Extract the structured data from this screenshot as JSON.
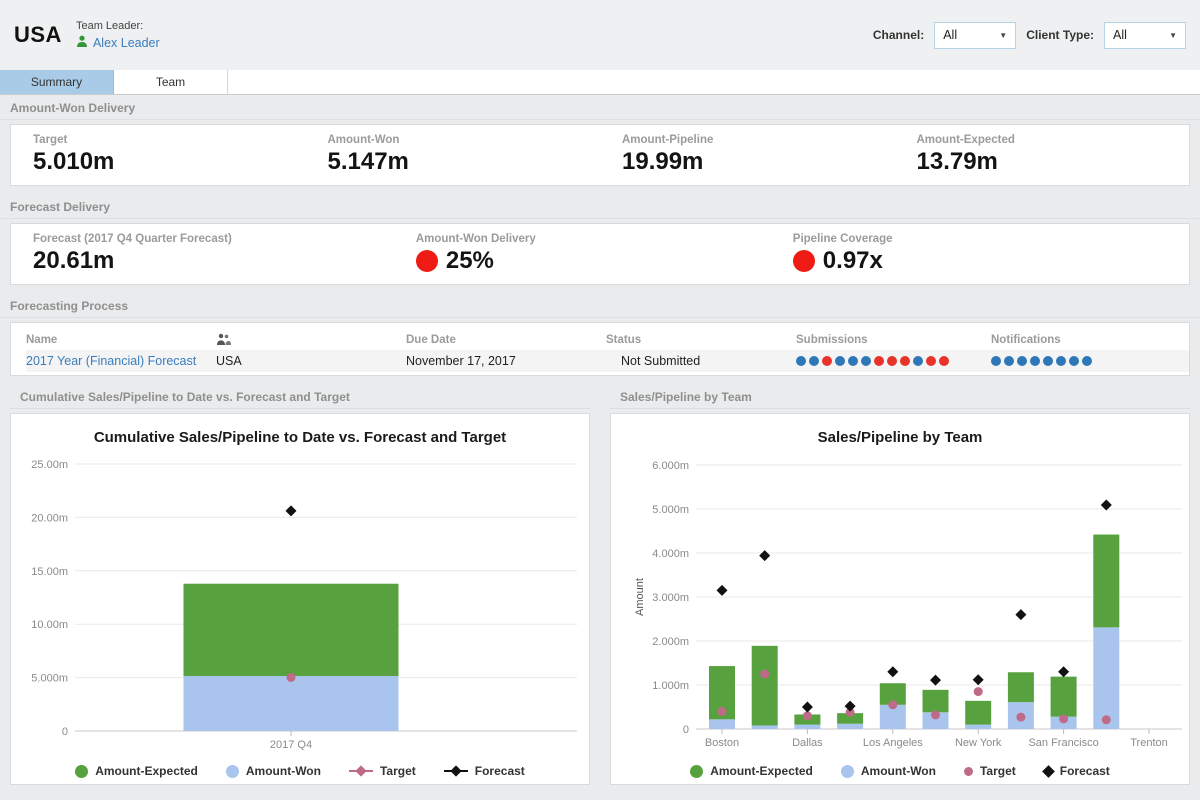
{
  "header": {
    "region": "USA",
    "team_leader_label": "Team Leader:",
    "team_leader_name": "Alex Leader",
    "filters": [
      {
        "label": "Channel:",
        "value": "All"
      },
      {
        "label": "Client Type:",
        "value": "All"
      }
    ]
  },
  "tabs": [
    {
      "label": "Summary"
    },
    {
      "label": "Team"
    }
  ],
  "sections": {
    "amount_won_delivery": {
      "title": "Amount-Won Delivery",
      "kpis": [
        {
          "label": "Target",
          "value": "5.010m"
        },
        {
          "label": "Amount-Won",
          "value": "5.147m"
        },
        {
          "label": "Amount-Pipeline",
          "value": "19.99m"
        },
        {
          "label": "Amount-Expected",
          "value": "13.79m"
        }
      ]
    },
    "forecast_delivery": {
      "title": "Forecast Delivery",
      "kpis": [
        {
          "label": "Forecast (2017 Q4 Quarter Forecast)",
          "value": "20.61m",
          "dot": "none"
        },
        {
          "label": "Amount-Won Delivery",
          "value": "25%",
          "dot": "red"
        },
        {
          "label": "Pipeline Coverage",
          "value": "0.97x",
          "dot": "red"
        }
      ]
    },
    "forecasting_process": {
      "title": "Forecasting Process",
      "col_name": "Name",
      "col_due": "Due Date",
      "col_status": "Status",
      "col_submissions": "Submissions",
      "col_notifications": "Notifications",
      "row": {
        "name": "2017 Year (Financial) Forecast",
        "team": "USA",
        "due_date": "November 17, 2017",
        "status": "Not Submitted",
        "submissions": [
          "blue",
          "blue",
          "red",
          "blue",
          "blue",
          "blue",
          "red",
          "red",
          "red",
          "blue",
          "red",
          "red"
        ],
        "notifications": [
          "blue",
          "blue",
          "blue",
          "blue",
          "blue",
          "blue",
          "blue",
          "blue"
        ]
      }
    }
  },
  "colors": {
    "green": "#57a13e",
    "light_blue": "#a9c5ee",
    "pink": "#c06a8a",
    "black": "#111111",
    "red_indicator": "#ee1c14",
    "blue_dot": "#2e78b8",
    "red_dot": "#e8332a",
    "link": "#3a7dbf",
    "active_tab": "#a9cbe8"
  },
  "chart_data": [
    {
      "type": "bar",
      "title": "Cumulative Sales/Pipeline to Date vs. Forecast and Target",
      "section_title": "Cumulative Sales/Pipeline to Date vs. Forecast and Target",
      "xlabel": "",
      "ylabel": "",
      "ymax": 25,
      "ylim": [
        0,
        25
      ],
      "grid": true,
      "legend_position": "bottom",
      "yticks": [
        {
          "v": 25,
          "label": "25.00m"
        },
        {
          "v": 20,
          "label": "20.00m"
        },
        {
          "v": 15,
          "label": "15.00m"
        },
        {
          "v": 10,
          "label": "10.00m"
        },
        {
          "v": 5,
          "label": "5.000m"
        },
        {
          "v": 0,
          "label": "0"
        }
      ],
      "categories": [
        "2017 Q4"
      ],
      "bars": [
        {
          "category": "2017 Q4",
          "amount_won": 5.147,
          "amount_expected": 8.643,
          "target": 5.01,
          "forecast": 20.61
        }
      ],
      "legend": [
        {
          "label": "Amount-Expected",
          "marker": "circle",
          "color_key": "green"
        },
        {
          "label": "Amount-Won",
          "marker": "circle",
          "color_key": "light_blue"
        },
        {
          "label": "Target",
          "marker": "diamond-line",
          "color_key": "pink"
        },
        {
          "label": "Forecast",
          "marker": "diamond-line",
          "color_key": "black"
        }
      ]
    },
    {
      "type": "bar",
      "title": "Sales/Pipeline by Team",
      "section_title": "Sales/Pipeline by Team",
      "xlabel": "",
      "ylabel": "Amount",
      "ymax": 6,
      "ylim": [
        0,
        6
      ],
      "grid": true,
      "legend_position": "bottom",
      "yticks": [
        {
          "v": 6,
          "label": "6.000m"
        },
        {
          "v": 5,
          "label": "5.000m"
        },
        {
          "v": 4,
          "label": "4.000m"
        },
        {
          "v": 3,
          "label": "3.000m"
        },
        {
          "v": 2,
          "label": "2.000m"
        },
        {
          "v": 1,
          "label": "1.000m"
        },
        {
          "v": 0,
          "label": "0"
        }
      ],
      "categories": [
        "Boston",
        "",
        "Dallas",
        "",
        "Los Angeles",
        "",
        "New York",
        "",
        "San Francisco",
        "",
        "Trenton"
      ],
      "bars": [
        {
          "category": "Boston",
          "amount_won": 0.22,
          "amount_expected": 1.21,
          "target": 0.4,
          "forecast": 3.15
        },
        {
          "category": "",
          "amount_won": 0.08,
          "amount_expected": 1.81,
          "target": 1.25,
          "forecast": 3.94
        },
        {
          "category": "Dallas",
          "amount_won": 0.1,
          "amount_expected": 0.23,
          "target": 0.3,
          "forecast": 0.5
        },
        {
          "category": "",
          "amount_won": 0.12,
          "amount_expected": 0.24,
          "target": 0.38,
          "forecast": 0.52
        },
        {
          "category": "Los Angeles",
          "amount_won": 0.55,
          "amount_expected": 0.49,
          "target": 0.55,
          "forecast": 1.3
        },
        {
          "category": "",
          "amount_won": 0.38,
          "amount_expected": 0.51,
          "target": 0.32,
          "forecast": 1.11
        },
        {
          "category": "New York",
          "amount_won": 0.1,
          "amount_expected": 0.54,
          "target": 0.85,
          "forecast": 1.12
        },
        {
          "category": "",
          "amount_won": 0.61,
          "amount_expected": 0.68,
          "target": 0.27,
          "forecast": 2.6
        },
        {
          "category": "San Francisco",
          "amount_won": 0.28,
          "amount_expected": 0.91,
          "target": 0.23,
          "forecast": 1.3
        },
        {
          "category": "",
          "amount_won": 2.31,
          "amount_expected": 2.11,
          "target": 0.21,
          "forecast": 5.09
        },
        {
          "category": "Trenton",
          "amount_won": null,
          "amount_expected": null,
          "target": null,
          "forecast": null
        }
      ],
      "legend": [
        {
          "label": "Amount-Expected",
          "marker": "circle",
          "color_key": "green"
        },
        {
          "label": "Amount-Won",
          "marker": "circle",
          "color_key": "light_blue"
        },
        {
          "label": "Target",
          "marker": "dot",
          "color_key": "pink"
        },
        {
          "label": "Forecast",
          "marker": "diamond",
          "color_key": "black"
        }
      ]
    }
  ]
}
